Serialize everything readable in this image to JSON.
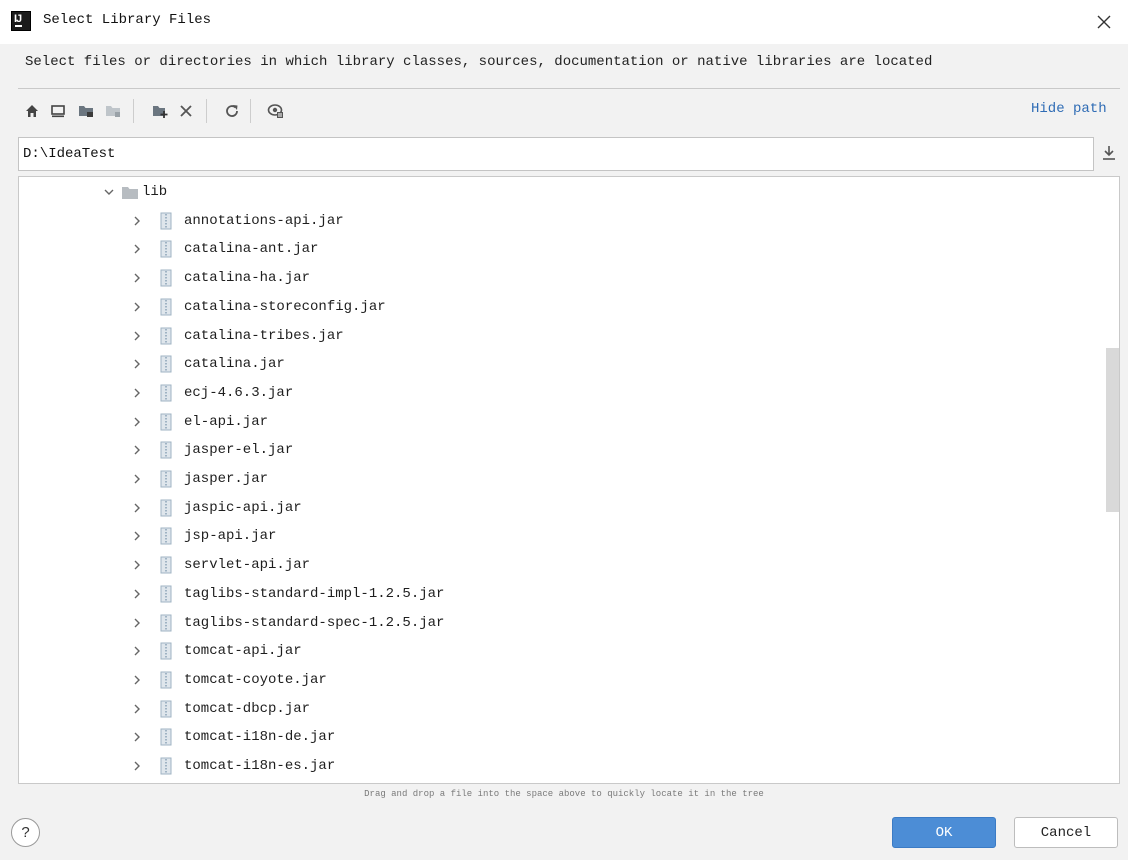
{
  "window": {
    "title": "Select Library Files",
    "app_icon_text": "IJ"
  },
  "description": "Select files or directories in which library classes, sources, documentation or native libraries are located",
  "toolbar": {
    "buttons": [
      "home-icon",
      "desktop-icon",
      "project-folder-icon",
      "module-folder-icon",
      "new-folder-icon",
      "delete-icon",
      "refresh-icon",
      "show-hidden-icon"
    ],
    "hide_path_label": "Hide path"
  },
  "path": {
    "value": "D:\\IdeaTest"
  },
  "tree": {
    "folder": {
      "name": "lib",
      "expanded": true
    },
    "files": [
      "annotations-api.jar",
      "catalina-ant.jar",
      "catalina-ha.jar",
      "catalina-storeconfig.jar",
      "catalina-tribes.jar",
      "catalina.jar",
      "ecj-4.6.3.jar",
      "el-api.jar",
      "jasper-el.jar",
      "jasper.jar",
      "jaspic-api.jar",
      "jsp-api.jar",
      "servlet-api.jar",
      "taglibs-standard-impl-1.2.5.jar",
      "taglibs-standard-spec-1.2.5.jar",
      "tomcat-api.jar",
      "tomcat-coyote.jar",
      "tomcat-dbcp.jar",
      "tomcat-i18n-de.jar",
      "tomcat-i18n-es.jar"
    ]
  },
  "drag_hint": "Drag and drop a file into the space above to quickly locate it in the tree",
  "buttons": {
    "help": "?",
    "ok": "OK",
    "cancel": "Cancel"
  },
  "colors": {
    "accent": "#4c8dd6",
    "link": "#2f6cb5",
    "folder": "#b7bcc1",
    "jar": "#9fb3c3"
  }
}
